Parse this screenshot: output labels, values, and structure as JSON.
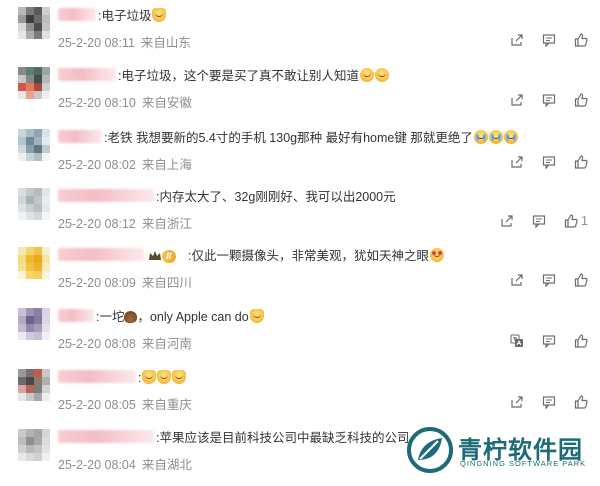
{
  "comments": [
    {
      "text": ":电子垃圾",
      "emojis": [
        "cat"
      ],
      "date": "25-2-20 08:11",
      "location": "来自山东",
      "likes": "",
      "has_translate": false
    },
    {
      "text": ":电子垃圾，这个要是买了真不敢让别人知道",
      "emojis": [
        "smile",
        "smile"
      ],
      "date": "25-2-20 08:10",
      "location": "来自安徽",
      "likes": "",
      "has_translate": false
    },
    {
      "text": ":老铁 我想要新的5.4寸的手机 130g那种 最好有home键 那就更绝了",
      "emojis": [
        "cry",
        "cry",
        "cry"
      ],
      "date": "25-2-20 08:02",
      "location": "来自上海",
      "likes": "",
      "has_translate": false
    },
    {
      "text": ":内存太大了、32g刚刚好、我可以出2000元",
      "emojis": [],
      "date": "25-2-20 08:12",
      "location": "来自浙江",
      "likes": "1",
      "has_translate": false
    },
    {
      "text": ":仅此一颗摄像头，非常美观，犹如天神之眼",
      "emojis": [
        "love"
      ],
      "date": "25-2-20 08:09",
      "location": "来自四川",
      "likes": "",
      "has_translate": false
    },
    {
      "text": ":一坨",
      "text_after": "，only Apple can do",
      "emojis": [
        "cat"
      ],
      "date": "25-2-20 08:08",
      "location": "来自河南",
      "likes": "",
      "has_translate": true
    },
    {
      "text": ":",
      "emojis": [
        "cat",
        "cat",
        "cat"
      ],
      "date": "25-2-20 08:05",
      "location": "来自重庆",
      "likes": "",
      "has_translate": false
    },
    {
      "text": ":苹果应该是目前科技公司中最缺乏科技的公司",
      "emojis": [],
      "date": "25-2-20 08:04",
      "location": "来自湖北",
      "likes": "",
      "has_translate": false
    }
  ],
  "watermark": {
    "title": "青柠软件园",
    "subtitle": "QINGNING SOFTWARE PARK"
  },
  "colors": {
    "text": "#333333",
    "meta": "#8e8e8e",
    "watermark": "#1d6a78",
    "icon": "#6b6b6b"
  }
}
